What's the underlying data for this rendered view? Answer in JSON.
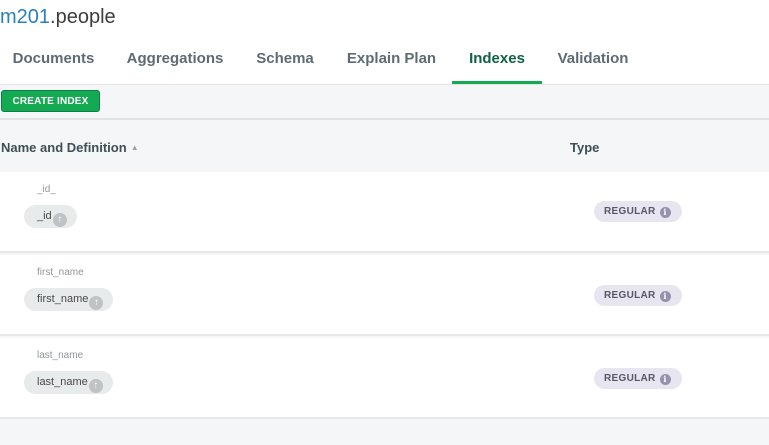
{
  "namespace": {
    "database": "m201",
    "collection": ".people"
  },
  "tabs": [
    {
      "label": "Documents",
      "active": false
    },
    {
      "label": "Aggregations",
      "active": false
    },
    {
      "label": "Schema",
      "active": false
    },
    {
      "label": "Explain Plan",
      "active": false
    },
    {
      "label": "Indexes",
      "active": true
    },
    {
      "label": "Validation",
      "active": false
    }
  ],
  "toolbar": {
    "create_index_label": "CREATE INDEX"
  },
  "table": {
    "columns": {
      "name": "Name and Definition",
      "type": "Type"
    },
    "sort_icon": "sort-up-icon",
    "rows": [
      {
        "name": "_id_",
        "field": "_id",
        "type": "REGULAR"
      },
      {
        "name": "first_name",
        "field": "first_name",
        "type": "REGULAR"
      },
      {
        "name": "last_name",
        "field": "last_name",
        "type": "REGULAR"
      }
    ]
  },
  "colors": {
    "accent": "#13aa52",
    "active_tab_text": "#116149",
    "namespace_db": "#2b7fbd",
    "badge_bg": "#e7e5ef"
  }
}
